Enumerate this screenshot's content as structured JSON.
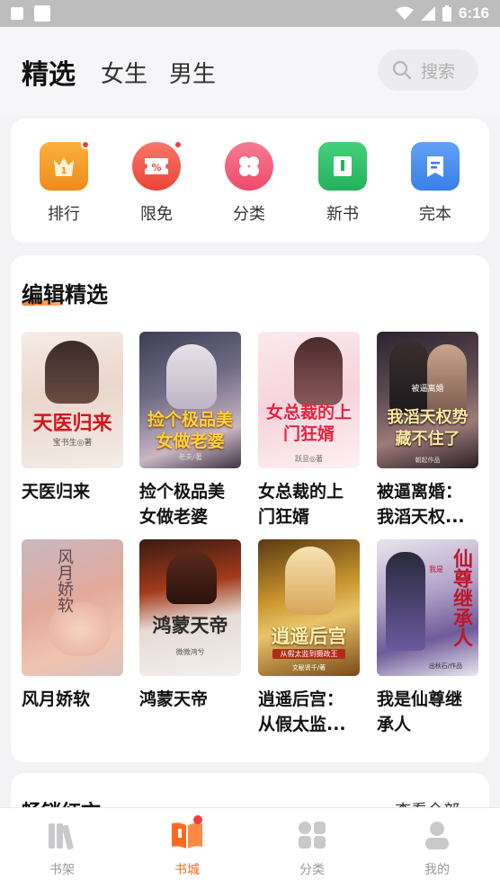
{
  "status_bar": {
    "time": "6:16"
  },
  "header": {
    "tabs": [
      {
        "label": "精选",
        "active": true
      },
      {
        "label": "女生",
        "active": false
      },
      {
        "label": "男生",
        "active": false
      }
    ],
    "search_placeholder": "搜索"
  },
  "categories": [
    {
      "label": "排行",
      "icon": "ranking-icon",
      "color": "#f39b2b",
      "badge": true
    },
    {
      "label": "限免",
      "icon": "coupon-icon",
      "color": "#f0584a",
      "badge": true
    },
    {
      "label": "分类",
      "icon": "clover-icon",
      "color": "#f45c7c",
      "badge": false
    },
    {
      "label": "新书",
      "icon": "new-book-icon",
      "color": "#33c26b",
      "badge": false
    },
    {
      "label": "完本",
      "icon": "finished-book-icon",
      "color": "#4a8ef0",
      "badge": false
    }
  ],
  "editor_section": {
    "title": "编辑精选",
    "books": [
      {
        "name": "天医归来",
        "cover_title": "天医归来",
        "cover_author": "宝书生◎著"
      },
      {
        "name": "捡个极品美女做老婆",
        "name_display": "捡个极品美女做老婆",
        "cover_title": "捡个极品美女做老婆",
        "cover_author": "老夫/著"
      },
      {
        "name": "女总裁的上门狂婿",
        "cover_title": "女总裁的上门狂婿",
        "cover_author": "跃旦◎著"
      },
      {
        "name": "被逼离婚：我滔天权...",
        "cover_title": "我滔天权势藏不住了",
        "cover_badge": "被逼离婚",
        "cover_author": "朝起作品"
      },
      {
        "name": "风月娇软",
        "cover_title": "风月娇软"
      },
      {
        "name": "鸿蒙天帝",
        "cover_title": "鸿蒙天帝",
        "cover_author": "微微鸿兮"
      },
      {
        "name": "逍遥后宫：从假太监...",
        "cover_title": "逍遥后宫",
        "cover_subtitle": "从假太监到摄政王",
        "cover_author": "文秘贤千/著"
      },
      {
        "name": "我是仙尊继承人",
        "cover_title": "仙尊继承人",
        "cover_small": "我是",
        "cover_author": "出秋石/作品"
      }
    ]
  },
  "hot_section": {
    "title": "畅销红文",
    "more": "查看全部 ›"
  },
  "tabbar": [
    {
      "label": "书架",
      "icon": "bookshelf-icon",
      "active": false
    },
    {
      "label": "书城",
      "icon": "bookstore-icon",
      "active": true
    },
    {
      "label": "分类",
      "icon": "category-grid-icon",
      "active": false
    },
    {
      "label": "我的",
      "icon": "profile-icon",
      "active": false
    }
  ],
  "colors": {
    "accent": "#ff6a1f",
    "badge": "#f03c3c"
  }
}
